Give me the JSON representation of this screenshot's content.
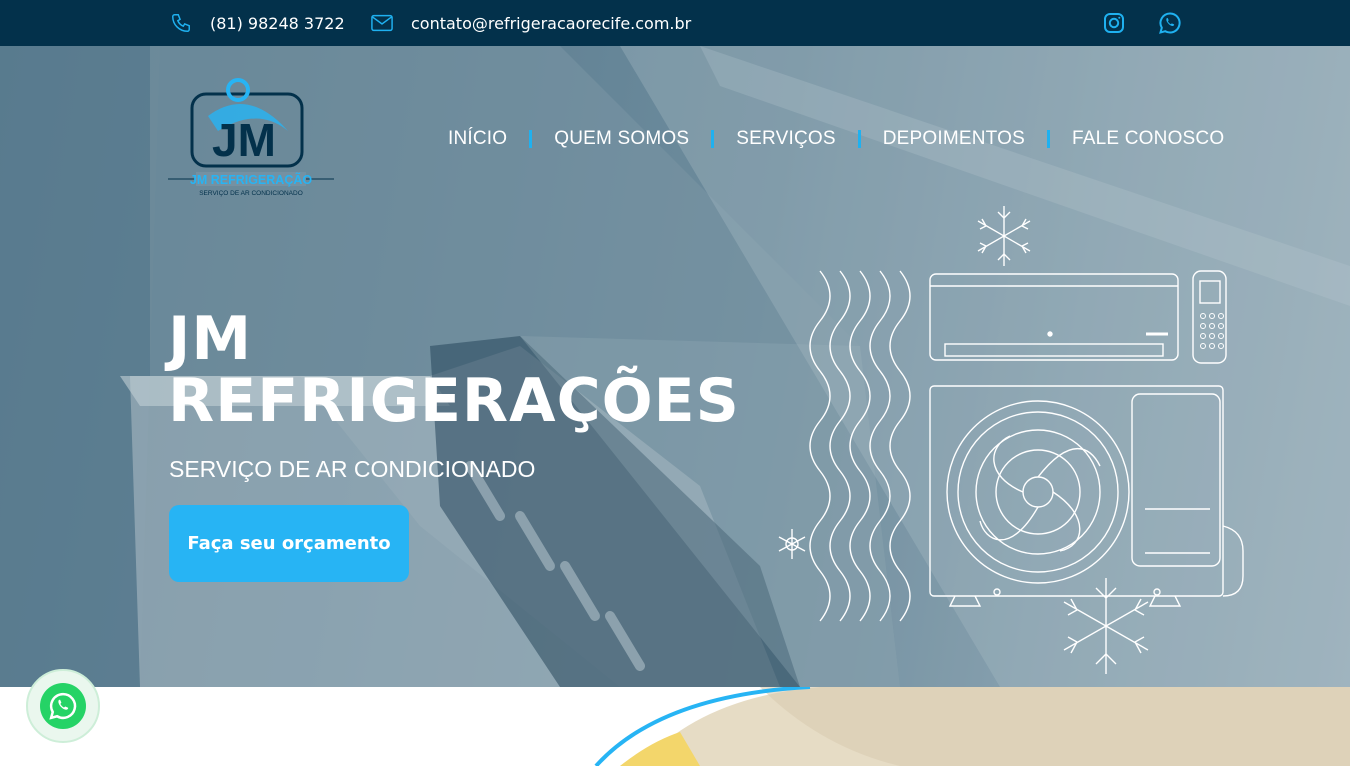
{
  "topbar": {
    "phone": "(81) 98248 3722",
    "email": "contato@refrigeracaorecife.com.br",
    "icons": [
      "phone-icon",
      "mail-icon",
      "instagram-icon",
      "whatsapp-icon"
    ]
  },
  "logo": {
    "name": "JM REFRIGERAÇÃO",
    "tagline": "SERVIÇO DE AR CONDICIONADO"
  },
  "nav": {
    "items": [
      {
        "label": "INÍCIO"
      },
      {
        "label": "QUEM SOMOS"
      },
      {
        "label": "SERVIÇOS"
      },
      {
        "label": "DEPOIMENTOS"
      },
      {
        "label": "FALE CONOSCO"
      }
    ]
  },
  "hero": {
    "title_line1": "JM",
    "title_line2": "REFRIGERAÇÕES",
    "subtitle": "SERVIÇO DE AR CONDICIONADO",
    "cta_label": "Faça seu orçamento"
  },
  "colors": {
    "topbar": "#03314b",
    "accent": "#27b4f4",
    "whatsapp": "#25d366"
  }
}
